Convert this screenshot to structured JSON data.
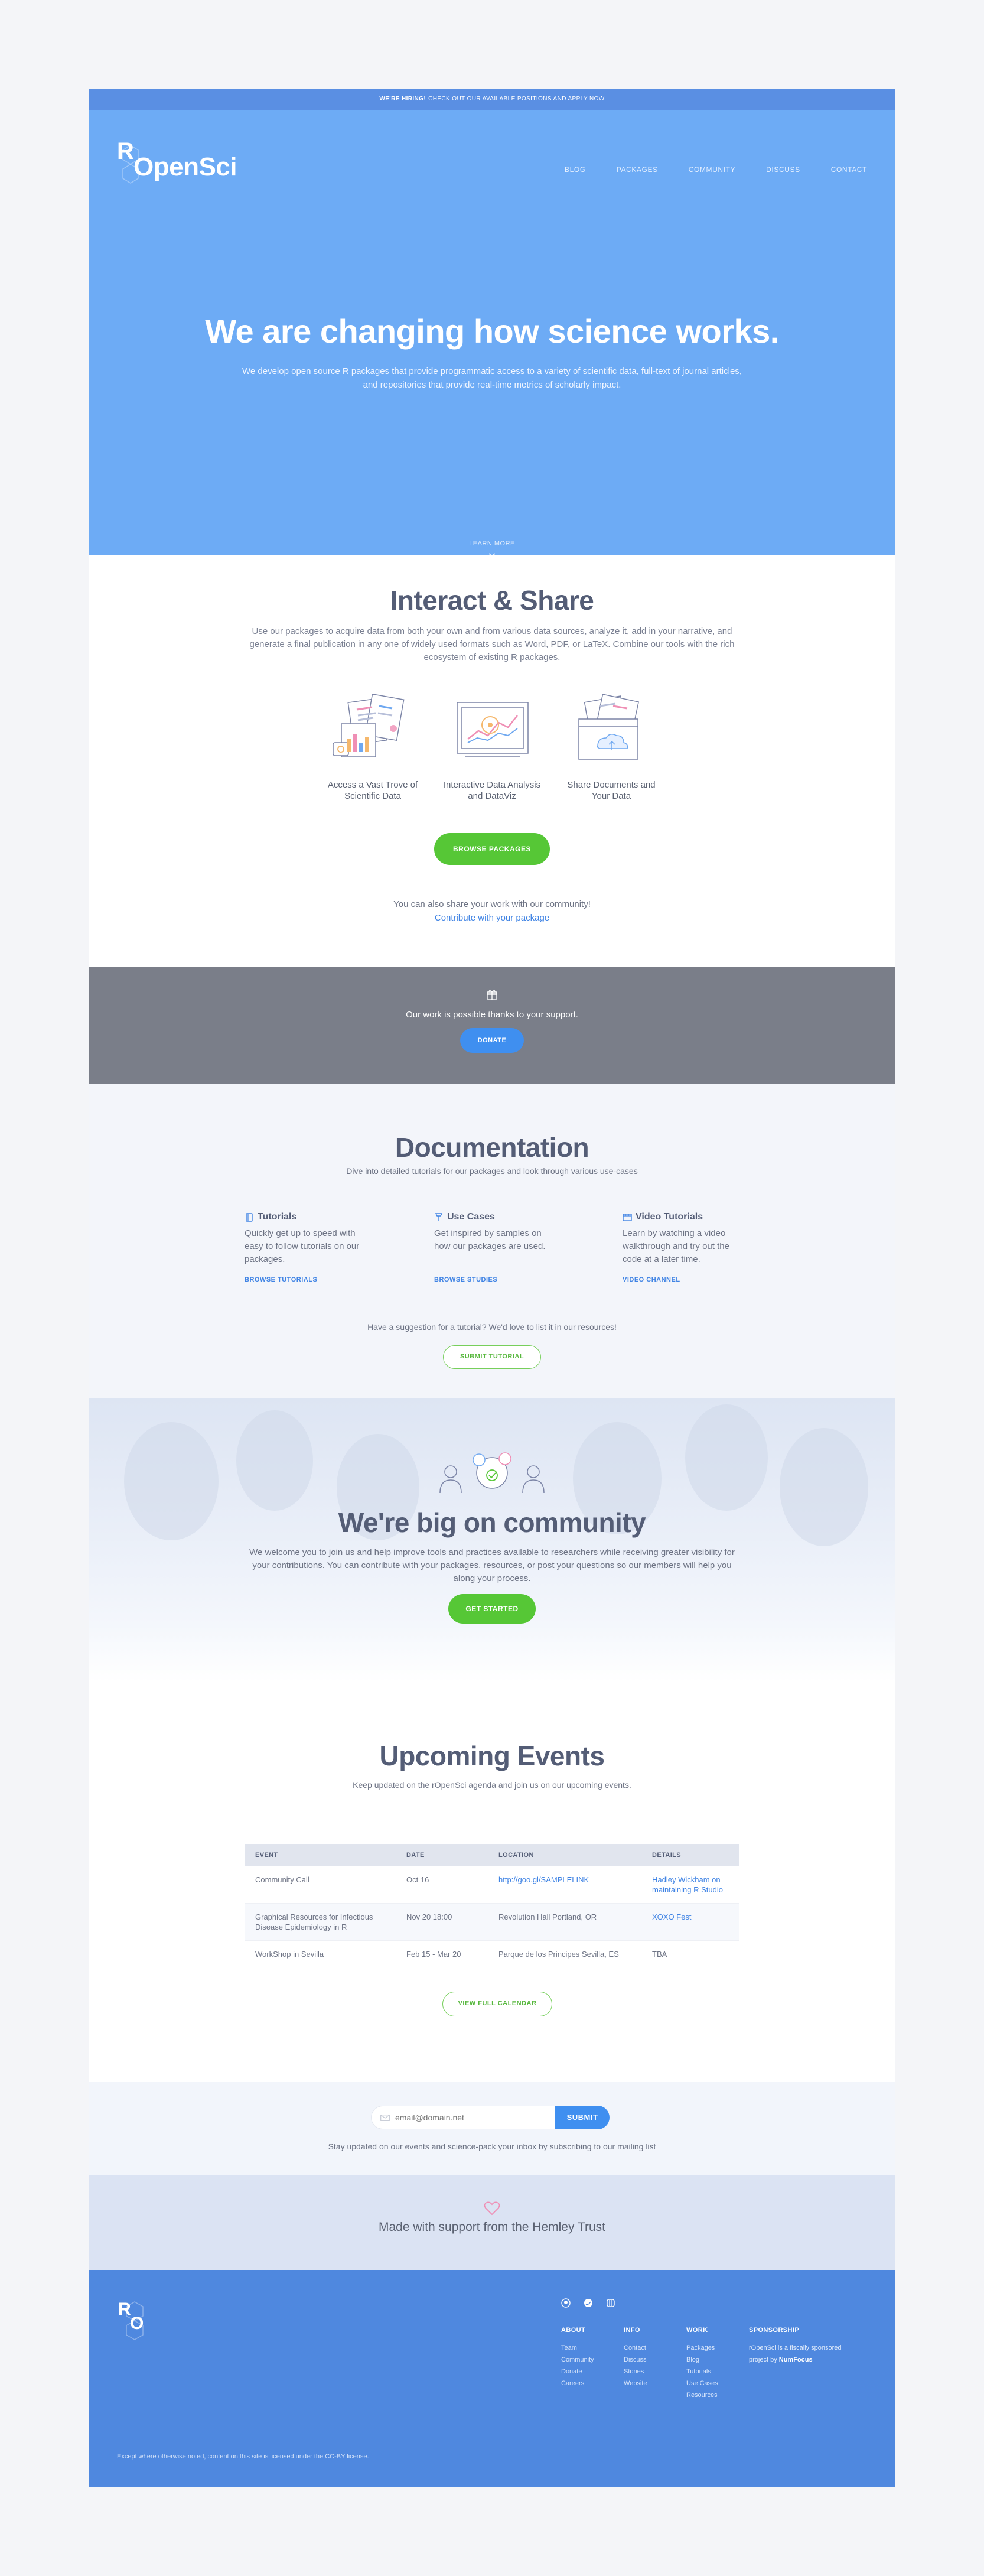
{
  "topbar": {
    "bold": "WE'RE HIRING!",
    "text": "CHECK OUT OUR AVAILABLE POSITIONS AND APPLY NOW"
  },
  "logo": {
    "r": "R",
    "word": "OpenSci"
  },
  "nav": [
    "BLOG",
    "PACKAGES",
    "COMMUNITY",
    "DISCUSS",
    "CONTACT"
  ],
  "hero": {
    "title": "We are changing how science works.",
    "lede": "We develop open source R packages that provide programmatic access to a variety of scientific data, full-text of journal articles, and repositories that provide real-time metrics of scholarly impact.",
    "learn_more": "LEARN MORE"
  },
  "interact": {
    "title": "Interact & Share",
    "text": "Use our packages to acquire data from both your own and from various data sources, analyze it, add in your narrative, and generate a final publication in any one of widely used formats such as Word, PDF, or LaTeX. Combine our tools with the rich ecosystem of existing R packages.",
    "features": [
      {
        "label": "Access a Vast Trove of Scientific Data",
        "icon": "data-trove-icon"
      },
      {
        "label": "Interactive Data Analysis and DataViz",
        "icon": "data-analysis-icon"
      },
      {
        "label": "Share Documents and Your Data",
        "icon": "share-documents-icon"
      }
    ],
    "button": "BROWSE PACKAGES",
    "share_text": "You can also share your work with our community!",
    "share_link": "Contribute with your package"
  },
  "support": {
    "text": "Our work is possible thanks to your support.",
    "button": "DONATE"
  },
  "docs": {
    "title": "Documentation",
    "subtitle": "Dive into detailed tutorials for our packages and look through various use-cases",
    "columns": [
      {
        "title": "Tutorials",
        "desc": "Quickly get up to speed with easy to follow tutorials on our packages.",
        "link": "BROWSE TUTORIALS",
        "icon": "book-icon"
      },
      {
        "title": "Use Cases",
        "desc": "Get inspired by samples on how our packages are used.",
        "link": "BROWSE STUDIES",
        "icon": "pin-icon"
      },
      {
        "title": "Video Tutorials",
        "desc": "Learn by watching a video walkthrough and try out the code at a later time.",
        "link": "VIDEO CHANNEL",
        "icon": "video-icon"
      }
    ],
    "suggest": "Have a suggestion for a tutorial? We'd love to list it in our resources!",
    "button": "SUBMIT TUTORIAL"
  },
  "community": {
    "title": "We're big on community",
    "text": "We welcome you to join us and help improve tools and practices available to researchers while receiving greater visibility for your contributions. You can contribute with your packages, resources, or post your questions so our members will help you along your process.",
    "button": "GET STARTED"
  },
  "events": {
    "title": "Upcoming Events",
    "subtitle": "Keep updated on the rOpenSci agenda and join us on our upcoming events.",
    "headers": [
      "EVENT",
      "DATE",
      "LOCATION",
      "DETAILS"
    ],
    "rows": [
      {
        "event": "Community Call",
        "date": "Oct 16",
        "location": "http://goo.gl/SAMPLELINK",
        "details": "Hadley Wickham on maintaining R Studio"
      },
      {
        "event": "Graphical Resources for Infectious Disease Epidemiology in R",
        "date": "Nov 20 18:00",
        "location": "Revolution Hall Portland, OR",
        "details": "XOXO Fest"
      },
      {
        "event": "WorkShop in Sevilla",
        "date": "Feb 15 - Mar 20",
        "location": "Parque de los Principes Sevilla, ES",
        "details": "TBA"
      }
    ],
    "button": "VIEW FULL CALENDAR"
  },
  "newsletter": {
    "placeholder": "email@domain.net",
    "button": "SUBMIT",
    "text": "Stay updated on our events and science-pack your inbox by subscribing to our mailing list"
  },
  "hemsley": {
    "text": "Made with support from the Hemley Trust"
  },
  "footer": {
    "about": {
      "title": "ABOUT",
      "items": [
        "Team",
        "Community",
        "Donate",
        "Careers"
      ]
    },
    "info": {
      "title": "INFO",
      "items": [
        "Contact",
        "Discuss",
        "Stories",
        "Website"
      ]
    },
    "work": {
      "title": "WORK",
      "items": [
        "Packages",
        "Blog",
        "Tutorials",
        "Use Cases",
        "Resources"
      ]
    },
    "sponsorship": {
      "title": "SPONSORSHIP",
      "text": "rOpenSci is a fiscally sponsored project by",
      "org": "NumFocus"
    },
    "copyright": "Except where otherwise noted, content on this site is licensed under the CC-BY license."
  },
  "colors": {
    "hero": "#6dabf5",
    "topbar": "#5a8fe3",
    "green": "#56c736",
    "blue": "#3f8ff0",
    "footer": "#4f88df",
    "support": "#7a7e89"
  }
}
